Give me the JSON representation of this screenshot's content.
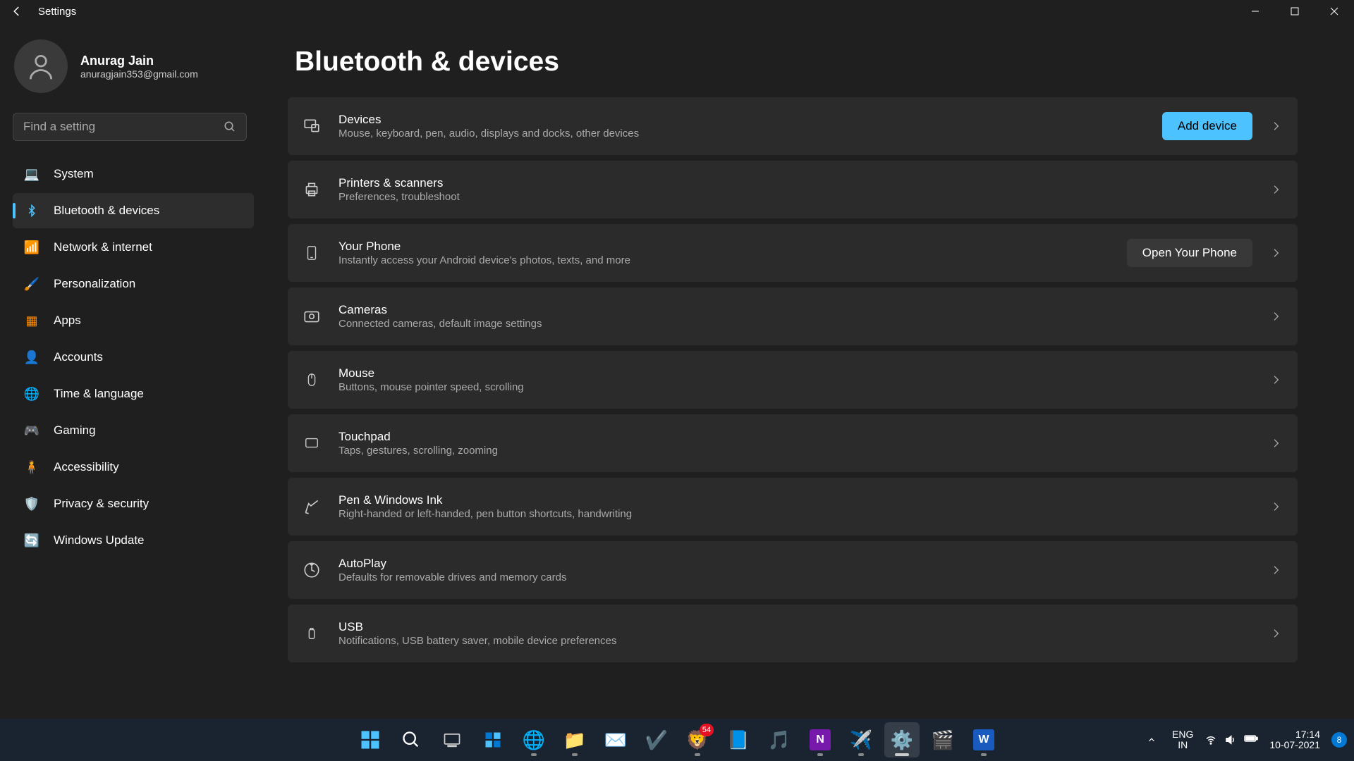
{
  "titlebar": {
    "app_title": "Settings"
  },
  "profile": {
    "name": "Anurag Jain",
    "email": "anuragjain353@gmail.com"
  },
  "search": {
    "placeholder": "Find a setting"
  },
  "sidebar": {
    "items": [
      {
        "label": "System",
        "icon": "💻"
      },
      {
        "label": "Bluetooth & devices",
        "icon": "bt",
        "active": true
      },
      {
        "label": "Network & internet",
        "icon": "📶"
      },
      {
        "label": "Personalization",
        "icon": "🖌️"
      },
      {
        "label": "Apps",
        "icon": "🔲"
      },
      {
        "label": "Accounts",
        "icon": "👤"
      },
      {
        "label": "Time & language",
        "icon": "🌐"
      },
      {
        "label": "Gaming",
        "icon": "🎮"
      },
      {
        "label": "Accessibility",
        "icon": "♿"
      },
      {
        "label": "Privacy & security",
        "icon": "🛡️"
      },
      {
        "label": "Windows Update",
        "icon": "🔄"
      }
    ]
  },
  "page": {
    "title": "Bluetooth & devices",
    "cards": [
      {
        "title": "Devices",
        "desc": "Mouse, keyboard, pen, audio, displays and docks, other devices",
        "action": "Add device",
        "action_style": "primary"
      },
      {
        "title": "Printers & scanners",
        "desc": "Preferences, troubleshoot"
      },
      {
        "title": "Your Phone",
        "desc": "Instantly access your Android device's photos, texts, and more",
        "action": "Open Your Phone",
        "action_style": "secondary"
      },
      {
        "title": "Cameras",
        "desc": "Connected cameras, default image settings"
      },
      {
        "title": "Mouse",
        "desc": "Buttons, mouse pointer speed, scrolling"
      },
      {
        "title": "Touchpad",
        "desc": "Taps, gestures, scrolling, zooming"
      },
      {
        "title": "Pen & Windows Ink",
        "desc": "Right-handed or left-handed, pen button shortcuts, handwriting"
      },
      {
        "title": "AutoPlay",
        "desc": "Defaults for removable drives and memory cards"
      },
      {
        "title": "USB",
        "desc": "Notifications, USB battery saver, mobile device preferences"
      }
    ]
  },
  "taskbar": {
    "badge_brave": "54",
    "lang1": "ENG",
    "lang2": "IN",
    "time": "17:14",
    "date": "10-07-2021",
    "notif_count": "8"
  }
}
